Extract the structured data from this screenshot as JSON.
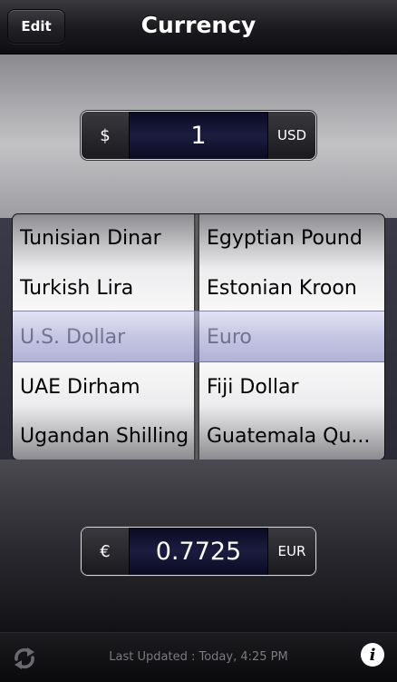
{
  "nav": {
    "edit_label": "Edit",
    "title": "Currency"
  },
  "from": {
    "symbol": "$",
    "amount": "1",
    "code": "USD"
  },
  "picker": {
    "left": [
      "Tunisian Dinar",
      "Turkish Lira",
      "U.S. Dollar",
      "UAE Dirham",
      "Ugandan Shilling"
    ],
    "right": [
      "Egyptian Pound",
      "Estonian Kroon",
      "Euro",
      "Fiji Dollar",
      "Guatemala Qu..."
    ],
    "selected_index": 2
  },
  "to": {
    "symbol": "€",
    "amount": "0.7725",
    "code": "EUR"
  },
  "footer": {
    "last_updated": "Last Updated : Today, 4:25 PM",
    "info_glyph": "i"
  },
  "icons": {
    "refresh": "refresh-icon",
    "info": "info-icon"
  }
}
